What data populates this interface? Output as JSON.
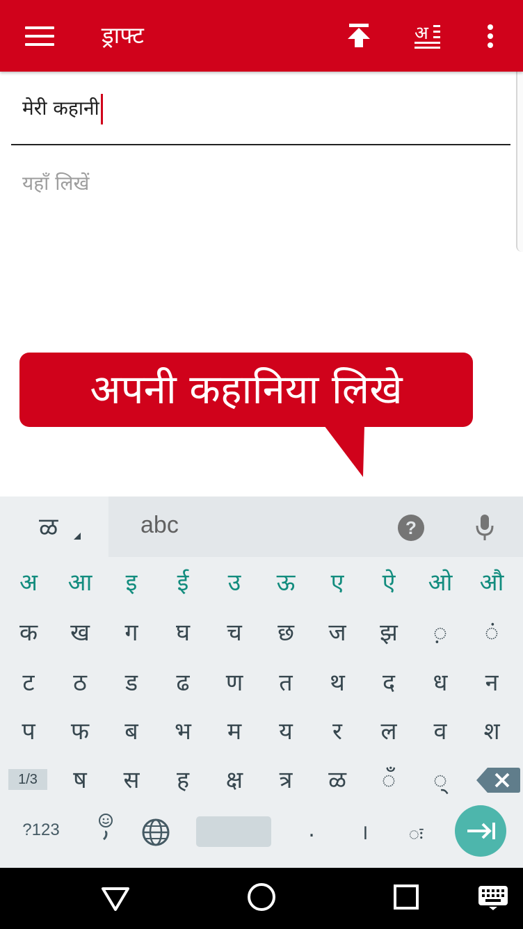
{
  "appbar": {
    "title": "ड्राफ्ट",
    "icons": [
      "menu-icon",
      "upload-icon",
      "transliterate-icon",
      "more-vert-icon"
    ]
  },
  "editor": {
    "title_value": "मेरी कहानी",
    "body_placeholder": "यहाँ लिखें"
  },
  "callout": {
    "text": "अपनी कहानिया लिखे"
  },
  "keyboard": {
    "lang_key": "ळ",
    "suggestion": "abc",
    "help_label": "?",
    "vowels": [
      "अ",
      "आ",
      "इ",
      "ई",
      "उ",
      "ऊ",
      "ए",
      "ऐ",
      "ओ",
      "औ"
    ],
    "row1": [
      "क",
      "ख",
      "ग",
      "घ",
      "च",
      "छ",
      "ज",
      "झ",
      "◌़",
      "◌ं"
    ],
    "row2": [
      "ट",
      "ठ",
      "ड",
      "ढ",
      "ण",
      "त",
      "थ",
      "द",
      "ध",
      "न"
    ],
    "row3": [
      "प",
      "फ",
      "ब",
      "भ",
      "म",
      "य",
      "र",
      "ल",
      "व",
      "श"
    ],
    "row4": [
      "ष",
      "स",
      "ह",
      "क्ष",
      "त्र",
      "ळ",
      "◌ँ",
      "◌्"
    ],
    "page_indicator": "1/3",
    "symbols_key": "?123",
    "period": ".",
    "danda": "।",
    "visarga": "◌ः"
  }
}
